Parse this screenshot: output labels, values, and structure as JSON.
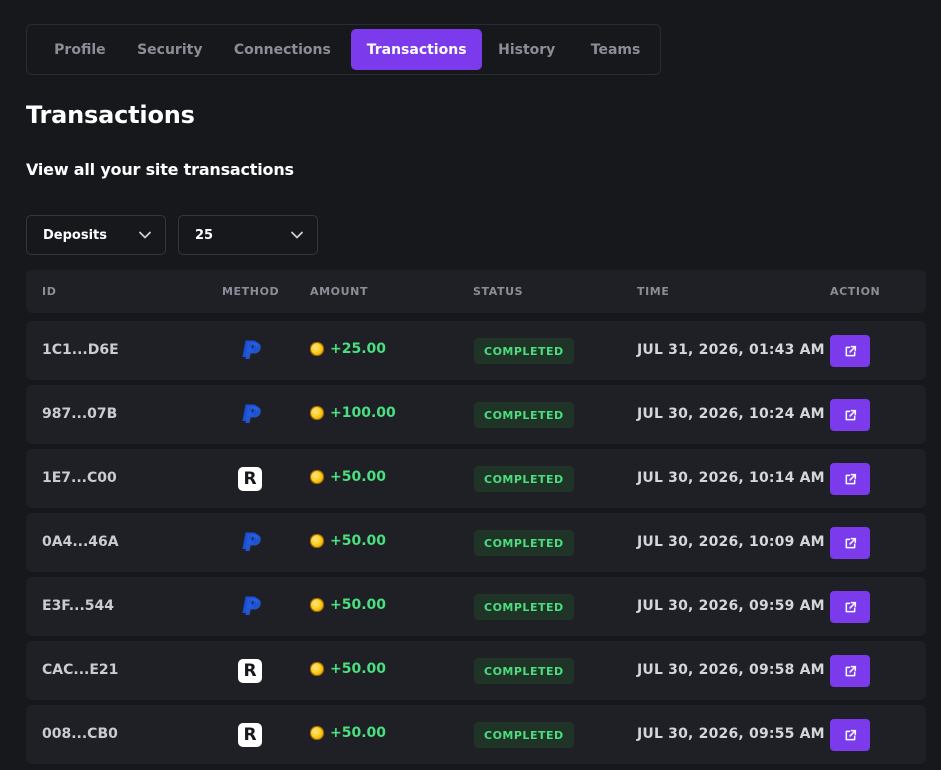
{
  "tabs": [
    {
      "label": "Profile",
      "active": false
    },
    {
      "label": "Security",
      "active": false
    },
    {
      "label": "Connections",
      "active": false
    },
    {
      "label": "Transactions",
      "active": true
    },
    {
      "label": "History",
      "active": false
    },
    {
      "label": "Teams",
      "active": false
    }
  ],
  "page": {
    "title": "Transactions",
    "subtitle": "View all your site transactions"
  },
  "filters": {
    "type_value": "Deposits",
    "count_value": "25"
  },
  "table": {
    "headers": {
      "id": "ID",
      "method": "METHOD",
      "amount": "AMOUNT",
      "status": "STATUS",
      "time": "TIME",
      "action": "ACTION"
    },
    "rows": [
      {
        "id": "1C1...D6E",
        "method": "paypal-icon",
        "amount": "+25.00",
        "status": "COMPLETED",
        "time": "JUL 31, 2026, 01:43 AM"
      },
      {
        "id": "987...07B",
        "method": "paypal-icon",
        "amount": "+100.00",
        "status": "COMPLETED",
        "time": "JUL 30, 2026, 10:24 AM"
      },
      {
        "id": "1E7...C00",
        "method": "revolut-icon",
        "amount": "+50.00",
        "status": "COMPLETED",
        "time": "JUL 30, 2026, 10:14 AM"
      },
      {
        "id": "0A4...46A",
        "method": "paypal-icon",
        "amount": "+50.00",
        "status": "COMPLETED",
        "time": "JUL 30, 2026, 10:09 AM"
      },
      {
        "id": "E3F...544",
        "method": "paypal-icon",
        "amount": "+50.00",
        "status": "COMPLETED",
        "time": "JUL 30, 2026, 09:59 AM"
      },
      {
        "id": "CAC...E21",
        "method": "revolut-icon",
        "amount": "+50.00",
        "status": "COMPLETED",
        "time": "JUL 30, 2026, 09:58 AM"
      },
      {
        "id": "008...CB0",
        "method": "revolut-icon",
        "amount": "+50.00",
        "status": "COMPLETED",
        "time": "JUL 30, 2026, 09:55 AM"
      }
    ]
  },
  "colors": {
    "accent": "#7c3aed",
    "background": "#17181c",
    "surface": "#1e2025",
    "success": "#4ade80",
    "success_bg": "#1f3326"
  }
}
